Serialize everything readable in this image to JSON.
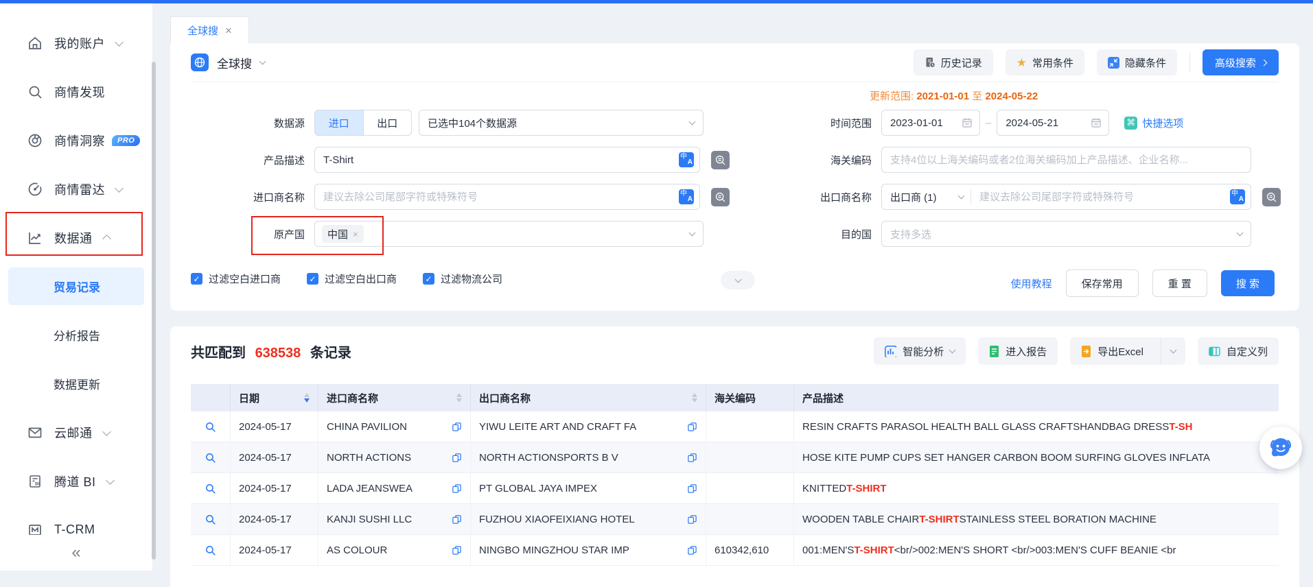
{
  "sidebar": {
    "items": [
      {
        "label": "我的账户"
      },
      {
        "label": "商情发现"
      },
      {
        "label": "商情洞察",
        "badge": "PRO"
      },
      {
        "label": "商情雷达"
      },
      {
        "label": "数据通"
      },
      {
        "label": "贸易记录"
      },
      {
        "label": "分析报告"
      },
      {
        "label": "数据更新"
      },
      {
        "label": "云邮通"
      },
      {
        "label": "腾道 BI"
      },
      {
        "label": "T-CRM"
      }
    ],
    "collapse": "«"
  },
  "tab": {
    "label": "全球搜",
    "close": "×"
  },
  "search": {
    "title": "全球搜",
    "actions": {
      "history": "历史记录",
      "favorites": "常用条件",
      "hide": "隐藏条件",
      "advanced": "高级搜索"
    },
    "update_range": {
      "label": "更新范围:",
      "from": "2021-01-01",
      "to_word": "至",
      "to": "2024-05-22"
    },
    "fields": {
      "data_source": {
        "label": "数据源",
        "toggle_import": "进口",
        "toggle_export": "出口",
        "selected": "已选中104个数据源"
      },
      "product_desc": {
        "label": "产品描述",
        "value": "T-Shirt"
      },
      "importer": {
        "label": "进口商名称",
        "placeholder": "建议去除公司尾部字符或特殊符号"
      },
      "origin_country": {
        "label": "原产国",
        "tag": "中国",
        "tag_close": "×"
      },
      "time_range": {
        "label": "时间范围",
        "start": "2023-01-01",
        "end": "2024-05-21",
        "quick": "快捷选项"
      },
      "hs_code": {
        "label": "海关编码",
        "placeholder": "支持4位以上海关编码或者2位海关编码加上产品描述、企业名称..."
      },
      "exporter": {
        "label": "出口商名称",
        "select": "出口商 (1)",
        "placeholder": "建议去除公司尾部字符或特殊符号"
      },
      "destination": {
        "label": "目的国",
        "placeholder": "支持多选"
      }
    },
    "checkboxes": [
      {
        "label": "过滤空白进口商",
        "checked": true
      },
      {
        "label": "过滤空白出口商",
        "checked": true
      },
      {
        "label": "过滤物流公司",
        "checked": true
      }
    ],
    "footer": {
      "tutorial": "使用教程",
      "save": "保存常用",
      "reset": "重 置",
      "search": "搜 索"
    }
  },
  "results": {
    "summary": {
      "prefix": "共匹配到",
      "count": "638538",
      "suffix": "条记录"
    },
    "toolbar": {
      "analysis": "智能分析",
      "report": "进入报告",
      "export": "导出Excel",
      "columns": "自定义列"
    },
    "table": {
      "columns": [
        "日期",
        "进口商名称",
        "出口商名称",
        "海关编码",
        "产品描述"
      ],
      "rows": [
        {
          "date": "2024-05-17",
          "importer": "CHINA PAVILION",
          "exporter": "YIWU LEITE ART AND CRAFT FA",
          "hs_code": "",
          "product": [
            {
              "t": "RESIN CRAFTS PARASOL HEALTH BALL GLASS CRAFTSHANDBAG DRESS ",
              "hl": false
            },
            {
              "t": "T-SH",
              "hl": true
            }
          ]
        },
        {
          "date": "2024-05-17",
          "importer": "NORTH ACTIONS",
          "exporter": "NORTH ACTIONSPORTS B V",
          "hs_code": "",
          "product": [
            {
              "t": "HOSE KITE PUMP CUPS SET HANGER CARBON BOOM SURFING GLOVES INFLATA",
              "hl": false
            }
          ]
        },
        {
          "date": "2024-05-17",
          "importer": "LADA JEANSWEA",
          "exporter": "PT GLOBAL JAYA IMPEX",
          "hs_code": "",
          "product": [
            {
              "t": "KNITTED ",
              "hl": false
            },
            {
              "t": "T-SHIRT",
              "hl": true
            }
          ]
        },
        {
          "date": "2024-05-17",
          "importer": "KANJI SUSHI LLC",
          "exporter": "FUZHOU XIAOFEIXIANG HOTEL",
          "hs_code": "",
          "product": [
            {
              "t": "WOODEN TABLE CHAIR ",
              "hl": false
            },
            {
              "t": "T-SHIRT",
              "hl": true
            },
            {
              "t": " STAINLESS STEEL BORATION MACHINE",
              "hl": false
            }
          ]
        },
        {
          "date": "2024-05-17",
          "importer": "AS COLOUR",
          "exporter": "NINGBO MINGZHOU STAR IMP",
          "hs_code": "610342,610",
          "product": [
            {
              "t": "001:MEN'S ",
              "hl": false
            },
            {
              "t": "T-SHIRT",
              "hl": true
            },
            {
              "t": " <br/>002:MEN'S SHORT <br/>003:MEN'S CUFF BEANIE <br",
              "hl": false
            }
          ]
        }
      ]
    }
  },
  "colors": {
    "primary": "#2b7bf6",
    "highlight_red": "#ee2f1f",
    "annotation_red": "#e3261d",
    "orange_dates": "#e8650c",
    "star_gold": "#efb041",
    "teal": "#3fc6b5"
  }
}
